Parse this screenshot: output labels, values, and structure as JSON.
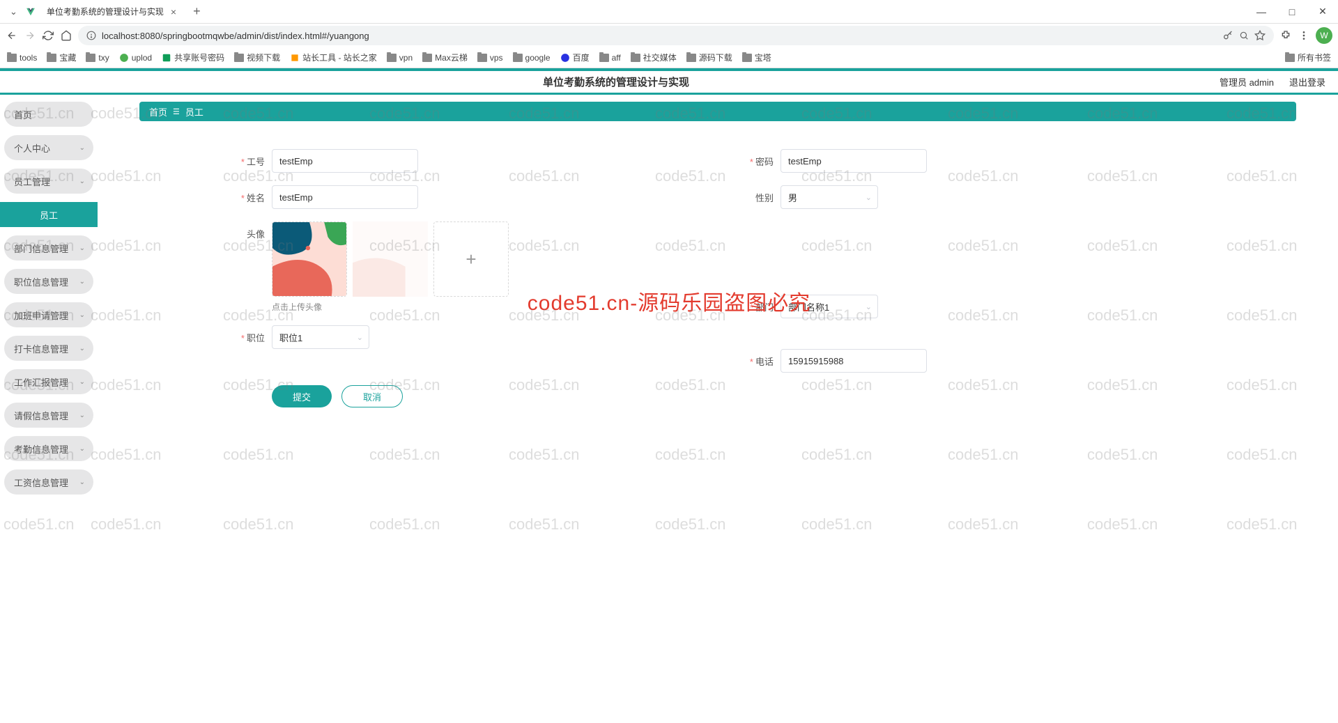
{
  "browser": {
    "tab_title": "单位考勤系统的管理设计与实现",
    "url": "localhost:8080/springbootmqwbe/admin/dist/index.html#/yuangong",
    "new_tab": "+",
    "avatar_letter": "W"
  },
  "bookmarks": {
    "items": [
      "tools",
      "宝藏",
      "txy",
      "uplod",
      "共享账号密码",
      "视频下载",
      "站长工具 - 站长之家",
      "vpn",
      "Max云梯",
      "vps",
      "google",
      "百度",
      "aff",
      "社交媒体",
      "源码下载",
      "宝塔"
    ],
    "right": "所有书签"
  },
  "header": {
    "title": "单位考勤系统的管理设计与实现",
    "admin": "管理员 admin",
    "logout": "退出登录"
  },
  "sidebar": {
    "items": [
      {
        "label": "首页",
        "expand": false
      },
      {
        "label": "个人中心",
        "expand": true
      },
      {
        "label": "员工管理",
        "expand": true
      },
      {
        "label": "员工",
        "active": true
      },
      {
        "label": "部门信息管理",
        "expand": true
      },
      {
        "label": "职位信息管理",
        "expand": true
      },
      {
        "label": "加班申请管理",
        "expand": true
      },
      {
        "label": "打卡信息管理",
        "expand": true
      },
      {
        "label": "工作汇报管理",
        "expand": true
      },
      {
        "label": "请假信息管理",
        "expand": true
      },
      {
        "label": "考勤信息管理",
        "expand": true
      },
      {
        "label": "工资信息管理",
        "expand": true
      }
    ]
  },
  "breadcrumb": {
    "home": "首页",
    "current": "员工"
  },
  "form": {
    "gonghao": {
      "label": "工号",
      "value": "testEmp"
    },
    "mima": {
      "label": "密码",
      "value": "testEmp"
    },
    "xingming": {
      "label": "姓名",
      "value": "testEmp"
    },
    "xingbie": {
      "label": "性别",
      "value": "男"
    },
    "touxiang": {
      "label": "头像",
      "tip": "点击上传头像"
    },
    "bumen": {
      "label": "部门",
      "value": "部门名称1"
    },
    "zhiwei": {
      "label": "职位",
      "value": "职位1"
    },
    "dianhua": {
      "label": "电话",
      "value": "15915915988"
    }
  },
  "buttons": {
    "submit": "提交",
    "cancel": "取消"
  },
  "watermark": {
    "text": "code51.cn",
    "center": "code51.cn-源码乐园盗图必究"
  }
}
